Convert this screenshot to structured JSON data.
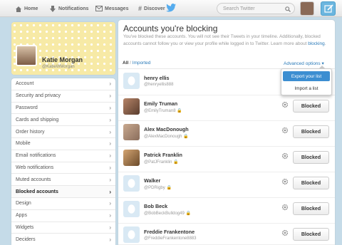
{
  "topnav": {
    "home": "Home",
    "notifications": "Notifications",
    "messages": "Messages",
    "discover": "Discover",
    "search_placeholder": "Search Twitter"
  },
  "profile": {
    "name": "Katie Morgan",
    "handle": "@KatieWMorgan"
  },
  "menu": [
    {
      "label": "Account"
    },
    {
      "label": "Security and privacy"
    },
    {
      "label": "Password"
    },
    {
      "label": "Cards and shipping"
    },
    {
      "label": "Order history"
    },
    {
      "label": "Mobile"
    },
    {
      "label": "Email notifications"
    },
    {
      "label": "Web notifications"
    },
    {
      "label": "Muted accounts"
    },
    {
      "label": "Blocked accounts",
      "active": true
    },
    {
      "label": "Design"
    },
    {
      "label": "Apps"
    },
    {
      "label": "Widgets"
    },
    {
      "label": "Deciders"
    }
  ],
  "main": {
    "title": "Accounts you're blocking",
    "description": "You've blocked these accounts. You will not see their Tweets in your timeline. Additionally, blocked accounts cannot follow you or view your profile while logged in to Twitter. Learn more about",
    "description_link": "blocking",
    "description_end": ".",
    "filter_all": "All",
    "filter_sep": " / ",
    "filter_imported": "Imported",
    "advanced_options": "Advanced options ▾"
  },
  "dropdown": {
    "export": "Export your list",
    "import": "Import a list"
  },
  "blocked_label": "Blocked",
  "accounts": [
    {
      "name": "henry ellis",
      "handle": "@henryellis888",
      "avatar": "egg",
      "locked": false
    },
    {
      "name": "Emily Truman",
      "handle": "@EmilyTruman8",
      "avatar": "photo-1",
      "locked": true
    },
    {
      "name": "Alex MacDonough",
      "handle": "@AlexMacDonough",
      "avatar": "photo-2",
      "locked": true
    },
    {
      "name": "Patrick Franklin",
      "handle": "@PatJFranklin",
      "avatar": "photo-3",
      "locked": true
    },
    {
      "name": "Walker",
      "handle": "@PDRigby",
      "avatar": "egg",
      "locked": true
    },
    {
      "name": "Bob Beck",
      "handle": "@BobBeckBulldog49",
      "avatar": "egg",
      "locked": true
    },
    {
      "name": "Freddie Frankentone",
      "handle": "@FreddieFrankentone8883",
      "avatar": "egg",
      "locked": false
    }
  ],
  "colors": {
    "accent": "#2b7bb9",
    "dropdown_highlight": "#3c8ed1",
    "profile_header": "#f7e89d"
  }
}
